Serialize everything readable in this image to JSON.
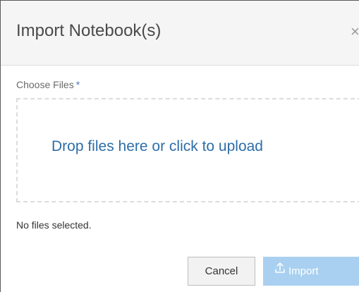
{
  "dialog": {
    "title": "Import Notebook(s)",
    "close_symbol": "×"
  },
  "field": {
    "label": "Choose Files",
    "required_marker": "*"
  },
  "dropzone": {
    "text": "Drop files here or click to upload"
  },
  "status": {
    "text": "No files selected."
  },
  "actions": {
    "cancel_label": "Cancel",
    "import_label": "Import",
    "import_icon": "upload-icon",
    "import_enabled": false
  },
  "colors": {
    "link_blue": "#2d6ea8",
    "primary_disabled": "#a9d0f0",
    "header_bg": "#f5f5f5"
  }
}
